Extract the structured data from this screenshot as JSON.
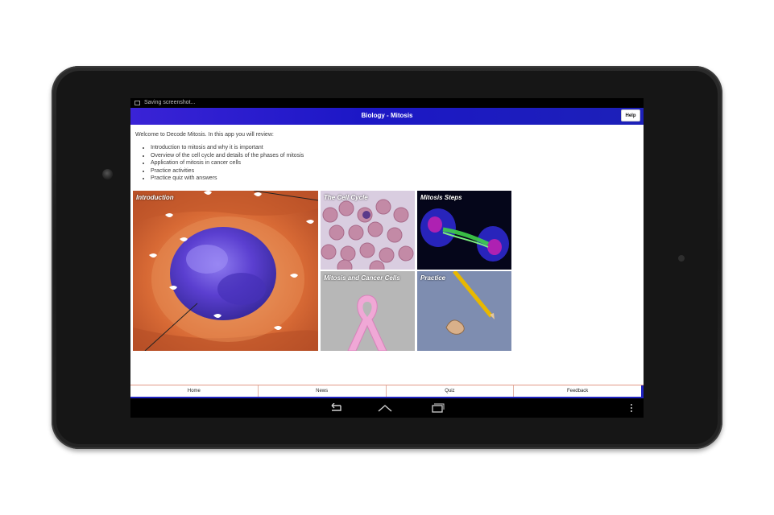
{
  "statusbar": {
    "notification_text": "Saving screenshot..."
  },
  "titlebar": {
    "title": "Biology - Mitosis",
    "help_label": "Help"
  },
  "intro": {
    "welcome": "Welcome to Decode Mitosis.  In this app you will review:",
    "items": [
      "Introduction to mitosis and why it is important",
      "Overview of the cell cycle and details of the phases of mitosis",
      "Application of mitosis in cancer cells",
      "Practice activities",
      "Practice quiz with answers"
    ]
  },
  "tiles": {
    "introduction": "Introduction",
    "cell_cycle": "The Cell Cycle",
    "mitosis_steps": "Mitosis Steps",
    "cancer_cells": "Mitosis and Cancer Cells",
    "practice": "Practice"
  },
  "tabs": [
    "Home",
    "News",
    "Quiz",
    "Feedback"
  ],
  "navbar": {
    "icons": [
      "back-icon",
      "home-icon",
      "recents-icon",
      "overflow-menu-icon"
    ]
  },
  "colors": {
    "titlebar": "#1c17c6",
    "tab_accent": "#1f23c0"
  }
}
